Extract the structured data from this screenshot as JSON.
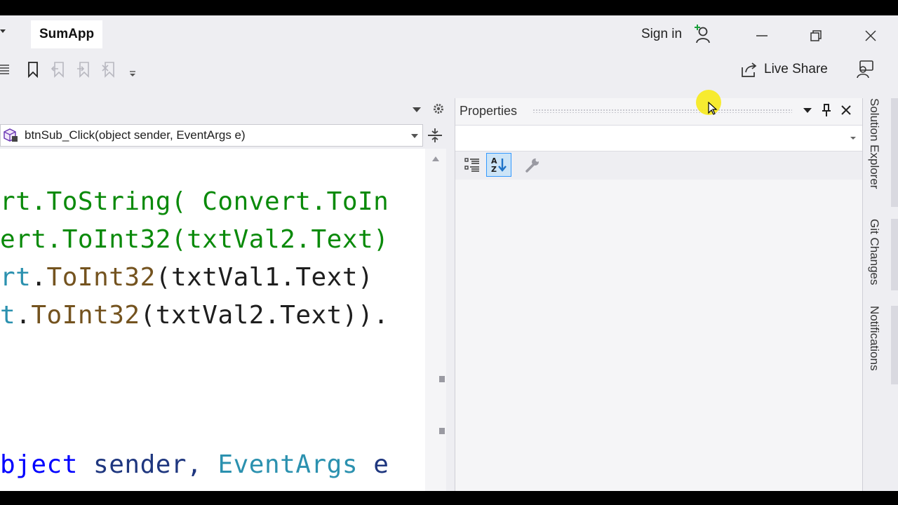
{
  "app": {
    "title": "SumApp",
    "sign_in_label": "Sign in",
    "live_share_label": "Live Share"
  },
  "editor": {
    "method_nav": "btnSub_Click(object sender, EventArgs e)",
    "code_lines": [
      {
        "segments": [
          {
            "t": "rt.ToString( Convert.ToIn",
            "c": "#0a8a0a"
          }
        ]
      },
      {
        "segments": [
          {
            "t": "ert.ToInt32(txtVal2.Text)",
            "c": "#0a8a0a"
          }
        ]
      },
      {
        "segments": [
          {
            "t": "rt",
            "c": "#2b91af"
          },
          {
            "t": ".",
            "c": "#1e1e1e"
          },
          {
            "t": "ToInt32",
            "c": "#74531f"
          },
          {
            "t": "(txtVal1.Text)",
            "c": "#1e1e1e"
          }
        ]
      },
      {
        "segments": [
          {
            "t": "t",
            "c": "#2b91af"
          },
          {
            "t": ".",
            "c": "#1e1e1e"
          },
          {
            "t": "ToInt32",
            "c": "#74531f"
          },
          {
            "t": "(txtVal2.Text)).",
            "c": "#1e1e1e"
          }
        ]
      },
      {
        "segments": [
          {
            "t": "bject",
            "c": "#0000ff"
          },
          {
            "t": " sender, ",
            "c": "#1f377f"
          },
          {
            "t": "EventArgs",
            "c": "#2b91af"
          },
          {
            "t": " e",
            "c": "#1f377f"
          }
        ]
      }
    ]
  },
  "properties": {
    "title": "Properties"
  },
  "side_tabs": [
    {
      "label": "Solution Explorer"
    },
    {
      "label": "Git Changes"
    },
    {
      "label": "Notifications"
    }
  ],
  "colors": {
    "accent": "#3399ff",
    "background": "#eeeef2"
  }
}
